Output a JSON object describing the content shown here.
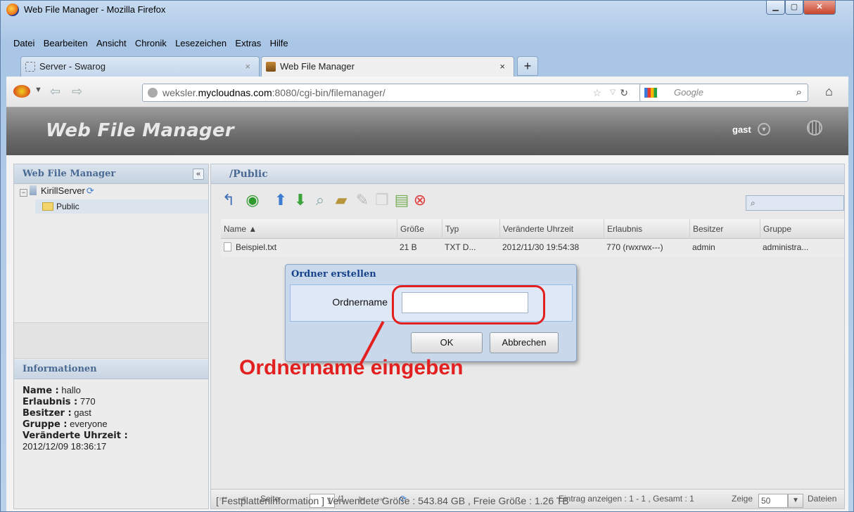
{
  "window": {
    "title": "Web File Manager - Mozilla Firefox"
  },
  "menu": [
    "Datei",
    "Bearbeiten",
    "Ansicht",
    "Chronik",
    "Lesezeichen",
    "Extras",
    "Hilfe"
  ],
  "tabs": [
    {
      "label": "Server - Swarog"
    },
    {
      "label": "Web File Manager"
    }
  ],
  "address": {
    "pre": "weksler.",
    "host": "mycloudnas.com",
    "post": ":8080/cgi-bin/filemanager/"
  },
  "search": {
    "placeholder": "Google"
  },
  "app": {
    "title": "Web File Manager",
    "user": "gast"
  },
  "left": {
    "title": "Web File Manager",
    "server": "KirillServer",
    "folder": "Public"
  },
  "info": {
    "title": "Informationen",
    "name_k": "Name :",
    "name_v": " hallo",
    "perm_k": "Erlaubnis :",
    "perm_v": " 770",
    "owner_k": "Besitzer :",
    "owner_v": " gast",
    "group_k": "Gruppe :",
    "group_v": " everyone",
    "mod_k": "Veränderte Uhrzeit :",
    "mod_v": "2012/12/09 18:36:17"
  },
  "path": "/Public",
  "grid": {
    "headers": [
      "Name ▲",
      "Größe",
      "Typ",
      "Veränderte Uhrzeit",
      "Erlaubnis",
      "Besitzer",
      "Gruppe"
    ],
    "row": [
      "Beispiel.txt",
      "21 B",
      "TXT D...",
      "2012/11/30 19:54:38",
      "770 (rwxrwx---)",
      "admin",
      "administra..."
    ]
  },
  "pager": {
    "page_label": "Seite",
    "page": "1",
    "of": "/1",
    "summary": "Eintrag anzeigen : 1 - 1 , Gesamt : 1",
    "show_label": "Zeige",
    "show": "50",
    "unit": "Dateien"
  },
  "footer": "[ Festplatteninformation ] Verwendete Größe : 543.84 GB , Freie Größe : 1.26 TB",
  "dialog": {
    "title": "Ordner erstellen",
    "label": "Ordnername",
    "ok": "OK",
    "cancel": "Abbrechen"
  },
  "annotation": "Ordnername eingeben",
  "colors": {
    "annotation": "#e32020",
    "header_bg": "#6b6b6b",
    "panel_title": "#4a6a94"
  }
}
